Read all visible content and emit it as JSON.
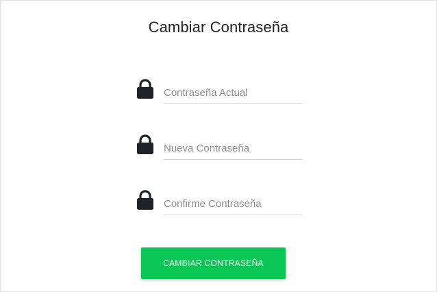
{
  "page": {
    "title": "Cambiar Contraseña"
  },
  "form": {
    "fields": [
      {
        "icon": "lock-icon",
        "placeholder": "Contraseña Actual",
        "value": ""
      },
      {
        "icon": "lock-icon",
        "placeholder": "Nueva Contraseña",
        "value": ""
      },
      {
        "icon": "lock-icon",
        "placeholder": "Confirme Contraseña",
        "value": ""
      }
    ],
    "submit_label": "CAMBIAR CONTRASEÑA"
  },
  "colors": {
    "accent": "#0ac655",
    "icon": "#1f2328",
    "text": "#222222",
    "placeholder": "#8a8a8a",
    "underline": "#cfcfcf"
  }
}
